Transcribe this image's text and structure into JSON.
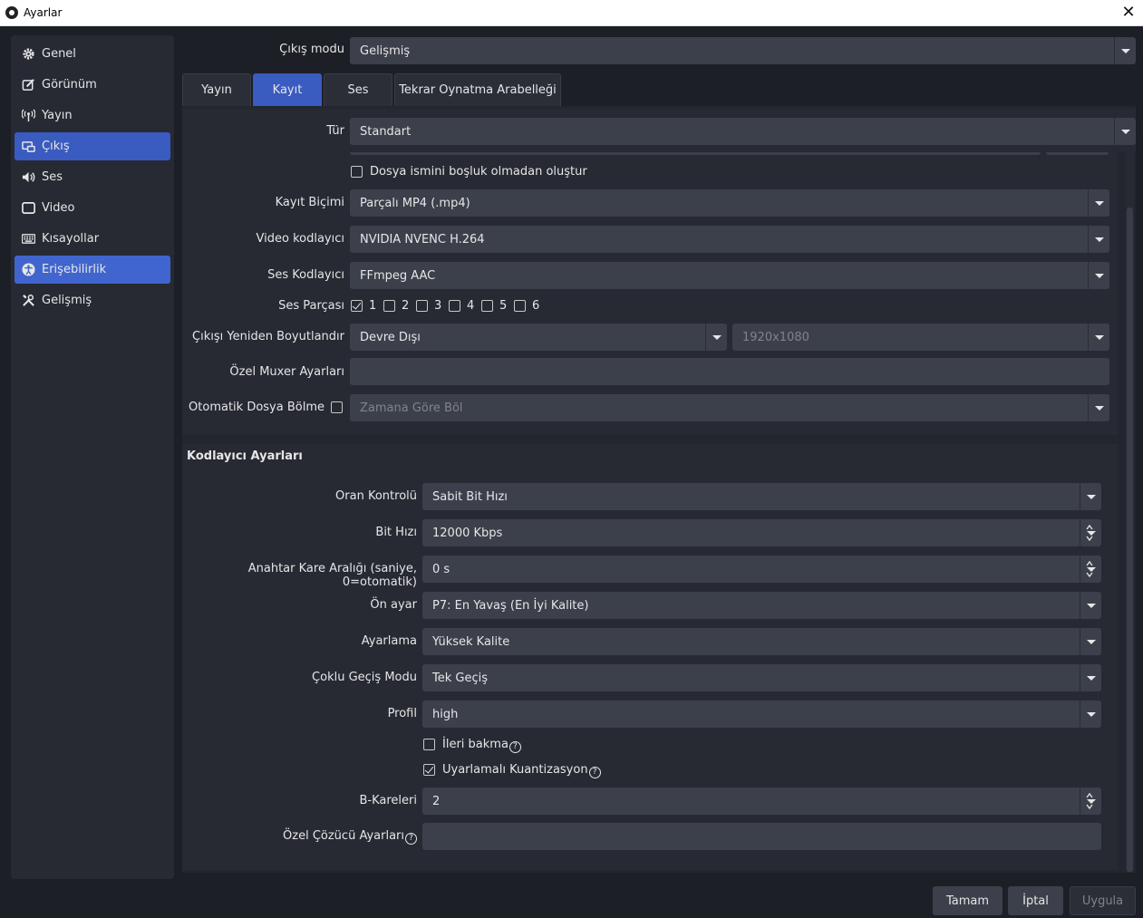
{
  "window": {
    "title": "Ayarlar"
  },
  "sidebar": {
    "items": [
      {
        "label": "Genel",
        "icon": "gear-icon"
      },
      {
        "label": "Görünüm",
        "icon": "edit-icon"
      },
      {
        "label": "Yayın",
        "icon": "antenna-icon"
      },
      {
        "label": "Çıkış",
        "icon": "output-icon"
      },
      {
        "label": "Ses",
        "icon": "speaker-icon"
      },
      {
        "label": "Video",
        "icon": "monitor-icon"
      },
      {
        "label": "Kısayollar",
        "icon": "keyboard-icon"
      },
      {
        "label": "Erişebilirlik",
        "icon": "accessibility-icon"
      },
      {
        "label": "Gelişmiş",
        "icon": "tools-icon"
      }
    ],
    "selected": "Çıkış",
    "hovered": "Erişebilirlik"
  },
  "output_mode": {
    "label": "Çıkış modu",
    "value": "Gelişmiş"
  },
  "tabs": [
    {
      "label": "Yayın"
    },
    {
      "label": "Kayıt"
    },
    {
      "label": "Ses"
    },
    {
      "label": "Tekrar Oynatma Arabelleği"
    }
  ],
  "active_tab": "Kayıt",
  "type": {
    "label": "Tür",
    "value": "Standart"
  },
  "recording": {
    "no_space_filename": {
      "label": "Dosya ismini boşluk olmadan oluştur",
      "checked": false
    },
    "format": {
      "label": "Kayıt Biçimi",
      "value": "Parçalı MP4 (.mp4)"
    },
    "video_encoder": {
      "label": "Video kodlayıcı",
      "value": "NVIDIA NVENC H.264"
    },
    "audio_encoder": {
      "label": "Ses Kodlayıcı",
      "value": "FFmpeg AAC"
    },
    "audio_track": {
      "label": "Ses Parçası",
      "tracks": [
        {
          "label": "1",
          "checked": true
        },
        {
          "label": "2",
          "checked": false
        },
        {
          "label": "3",
          "checked": false
        },
        {
          "label": "4",
          "checked": false
        },
        {
          "label": "5",
          "checked": false
        },
        {
          "label": "6",
          "checked": false
        }
      ]
    },
    "rescale": {
      "label": "Çıkışı Yeniden Boyutlandır",
      "value": "Devre Dışı",
      "resolution": "1920x1080"
    },
    "muxer": {
      "label": "Özel Muxer Ayarları",
      "value": ""
    },
    "auto_split": {
      "label": "Otomatik Dosya Bölme",
      "checked": false,
      "value": "Zamana Göre Böl"
    }
  },
  "encoder": {
    "title": "Kodlayıcı Ayarları",
    "rate_control": {
      "label": "Oran Kontrolü",
      "value": "Sabit Bit Hızı"
    },
    "bitrate": {
      "label": "Bit Hızı",
      "value": "12000 Kbps"
    },
    "keyframe": {
      "label": "Anahtar Kare Aralığı (saniye, 0=otomatik)",
      "value": "0 s"
    },
    "preset": {
      "label": "Ön ayar",
      "value": "P7: En Yavaş (En İyi Kalite)"
    },
    "tuning": {
      "label": "Ayarlama",
      "value": "Yüksek Kalite"
    },
    "multipass": {
      "label": "Çoklu Geçiş Modu",
      "value": "Tek Geçiş"
    },
    "profile": {
      "label": "Profil",
      "value": "high"
    },
    "lookahead": {
      "label": "İleri bakma",
      "checked": false
    },
    "adaptive_quant": {
      "label": "Uyarlamalı Kuantizasyon",
      "checked": true
    },
    "bframes": {
      "label": "B-Kareleri",
      "value": "2"
    },
    "custom_decoder": {
      "label": "Özel Çözücü Ayarları",
      "value": ""
    }
  },
  "buttons": {
    "ok": "Tamam",
    "cancel": "İptal",
    "apply": "Uygula"
  },
  "colors": {
    "accent": "#3a5bbf",
    "background": "#1d1f26",
    "panel": "#272a33",
    "control": "#3c404b"
  }
}
